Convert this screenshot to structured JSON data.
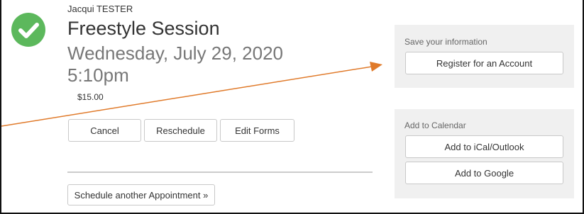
{
  "appointment": {
    "client_name": "Jacqui TESTER",
    "title": "Freestyle Session",
    "date": "Wednesday, July 29, 2020",
    "time": "5:10pm",
    "price": "$15.00",
    "status_icon": "check-circle-icon"
  },
  "actions": {
    "cancel_label": "Cancel",
    "reschedule_label": "Reschedule",
    "edit_forms_label": "Edit Forms",
    "schedule_another_label": "Schedule another Appointment »"
  },
  "save_panel": {
    "title": "Save your information",
    "register_label": "Register for an Account"
  },
  "calendar_panel": {
    "title": "Add to Calendar",
    "ical_label": "Add to iCal/Outlook",
    "google_label": "Add to Google"
  },
  "colors": {
    "success": "#5cb85c",
    "annotation_arrow": "#e07a2a",
    "panel_bg": "#f0f0f0"
  }
}
